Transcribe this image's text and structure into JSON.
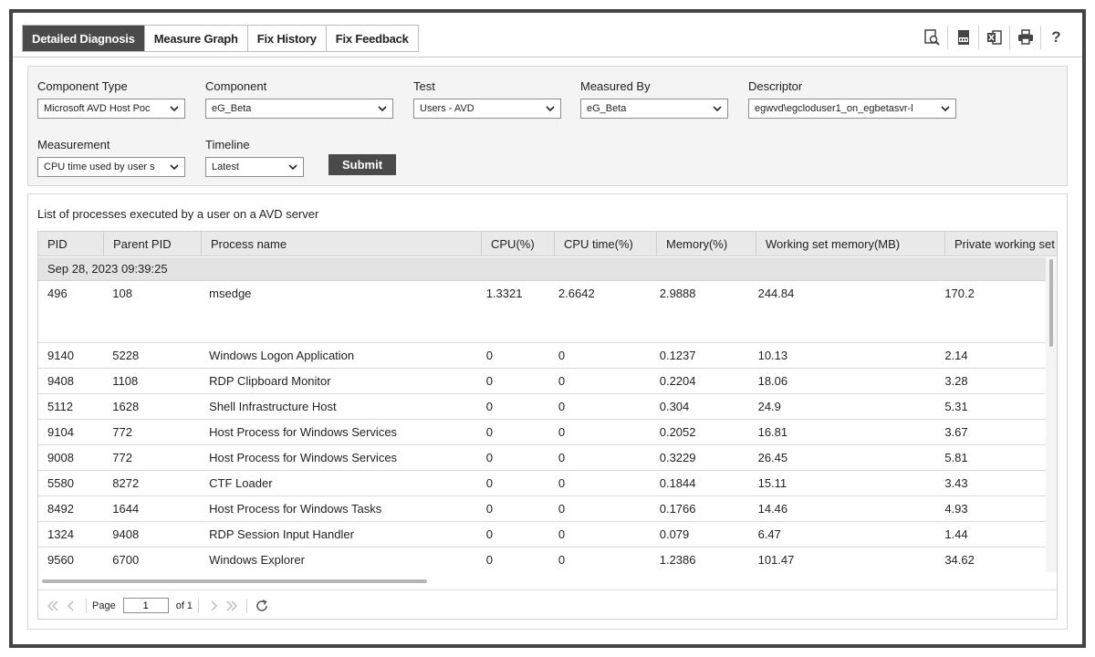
{
  "tabs": [
    {
      "label": "Detailed Diagnosis",
      "active": true
    },
    {
      "label": "Measure Graph",
      "active": false
    },
    {
      "label": "Fix History",
      "active": false
    },
    {
      "label": "Fix Feedback",
      "active": false
    }
  ],
  "toolbar_icons": [
    "zoom-search-icon",
    "pdf-icon",
    "excel-icon",
    "print-icon",
    "help-icon"
  ],
  "help_glyph": "?",
  "filters": {
    "component_type": {
      "label": "Component Type",
      "value": "Microsoft AVD Host Poc"
    },
    "component": {
      "label": "Component",
      "value": "eG_Beta"
    },
    "test": {
      "label": "Test",
      "value": "Users - AVD"
    },
    "measured_by": {
      "label": "Measured By",
      "value": "eG_Beta"
    },
    "descriptor": {
      "label": "Descriptor",
      "value": "egwvd\\egcloduser1_on_egbetasvr-l"
    },
    "measurement": {
      "label": "Measurement",
      "value": "CPU time used by user s"
    },
    "timeline": {
      "label": "Timeline",
      "value": "Latest"
    },
    "submit_label": "Submit"
  },
  "table": {
    "caption": "List of processes executed by a user on a AVD server",
    "columns": [
      "PID",
      "Parent PID",
      "Process name",
      "CPU(%)",
      "CPU time(%)",
      "Memory(%)",
      "Working set memory(MB)",
      "Private working set"
    ],
    "group_label": "Sep 28, 2023 09:39:25",
    "rows": [
      [
        "496",
        "108",
        "msedge",
        "1.3321",
        "2.6642",
        "2.9888",
        "244.84",
        "170.2"
      ],
      [
        "9140",
        "5228",
        "Windows Logon Application",
        "0",
        "0",
        "0.1237",
        "10.13",
        "2.14"
      ],
      [
        "9408",
        "1108",
        "RDP Clipboard Monitor",
        "0",
        "0",
        "0.2204",
        "18.06",
        "3.28"
      ],
      [
        "5112",
        "1628",
        "Shell Infrastructure Host",
        "0",
        "0",
        "0.304",
        "24.9",
        "5.31"
      ],
      [
        "9104",
        "772",
        "Host Process for Windows Services",
        "0",
        "0",
        "0.2052",
        "16.81",
        "3.67"
      ],
      [
        "9008",
        "772",
        "Host Process for Windows Services",
        "0",
        "0",
        "0.3229",
        "26.45",
        "5.81"
      ],
      [
        "5580",
        "8272",
        "CTF Loader",
        "0",
        "0",
        "0.1844",
        "15.11",
        "3.43"
      ],
      [
        "8492",
        "1644",
        "Host Process for Windows Tasks",
        "0",
        "0",
        "0.1766",
        "14.46",
        "4.93"
      ],
      [
        "1324",
        "9408",
        "RDP Session Input Handler",
        "0",
        "0",
        "0.079",
        "6.47",
        "1.44"
      ],
      [
        "9560",
        "6700",
        "Windows Explorer",
        "0",
        "0",
        "1.2386",
        "101.47",
        "34.62"
      ]
    ]
  },
  "pager": {
    "page_label": "Page",
    "page_value": "1",
    "of_label": "of 1"
  },
  "colors": {
    "active_tab": "#4a4a4a",
    "frame": "#454545",
    "header_bg": "#e9e9e9",
    "group_bg": "#e3e3e3"
  }
}
